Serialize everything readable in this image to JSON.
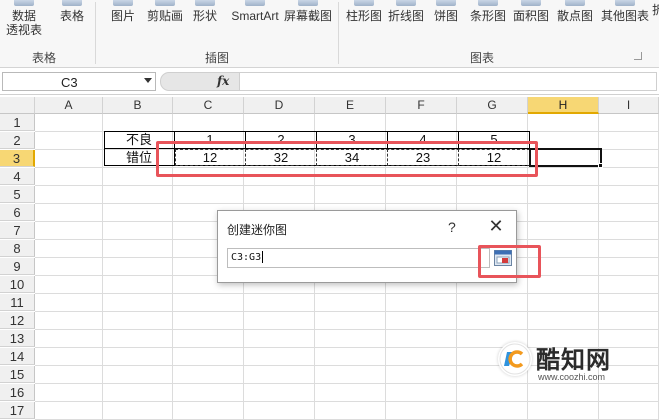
{
  "ribbon": {
    "buttons": {
      "pivot_line1": "数据",
      "pivot_line2": "透视表",
      "table": "表格",
      "picture": "图片",
      "clipart": "剪贴画",
      "shapes": "形状",
      "smartart": "SmartArt",
      "screenshot": "屏幕截图",
      "column": "柱形图",
      "line": "折线图",
      "pie": "饼图",
      "bar": "条形图",
      "area": "面积图",
      "scatter": "散点图",
      "other": "其他图表",
      "more": "折"
    },
    "groups": {
      "tables": "表格",
      "illustrations": "插图",
      "charts": "图表"
    }
  },
  "formula_bar": {
    "name_box": "C3",
    "fx": "fx",
    "content": ""
  },
  "grid": {
    "columns": [
      "A",
      "B",
      "C",
      "D",
      "E",
      "F",
      "G",
      "H",
      "I"
    ],
    "selected_column": "H",
    "rows": [
      "1",
      "2",
      "3",
      "4",
      "5",
      "6",
      "7",
      "8",
      "9",
      "10",
      "11",
      "12",
      "13",
      "14",
      "15",
      "16",
      "17",
      "18"
    ],
    "selected_row": "3",
    "cells": {
      "B2": "不良",
      "C2": "1",
      "D2": "2",
      "E2": "3",
      "F2": "4",
      "G2": "5",
      "B3": "错位",
      "C3": "12",
      "D3": "32",
      "E3": "34",
      "F3": "23",
      "G3": "12"
    }
  },
  "dialog": {
    "title": "创建迷你图",
    "help": "?",
    "close": "✕",
    "range_value": "C3:G3"
  },
  "watermark": {
    "title": "酷知网",
    "url": "www.coozhi.com"
  },
  "colors": {
    "highlight_red": "#e8545a",
    "selected_header": "#f7d774"
  }
}
